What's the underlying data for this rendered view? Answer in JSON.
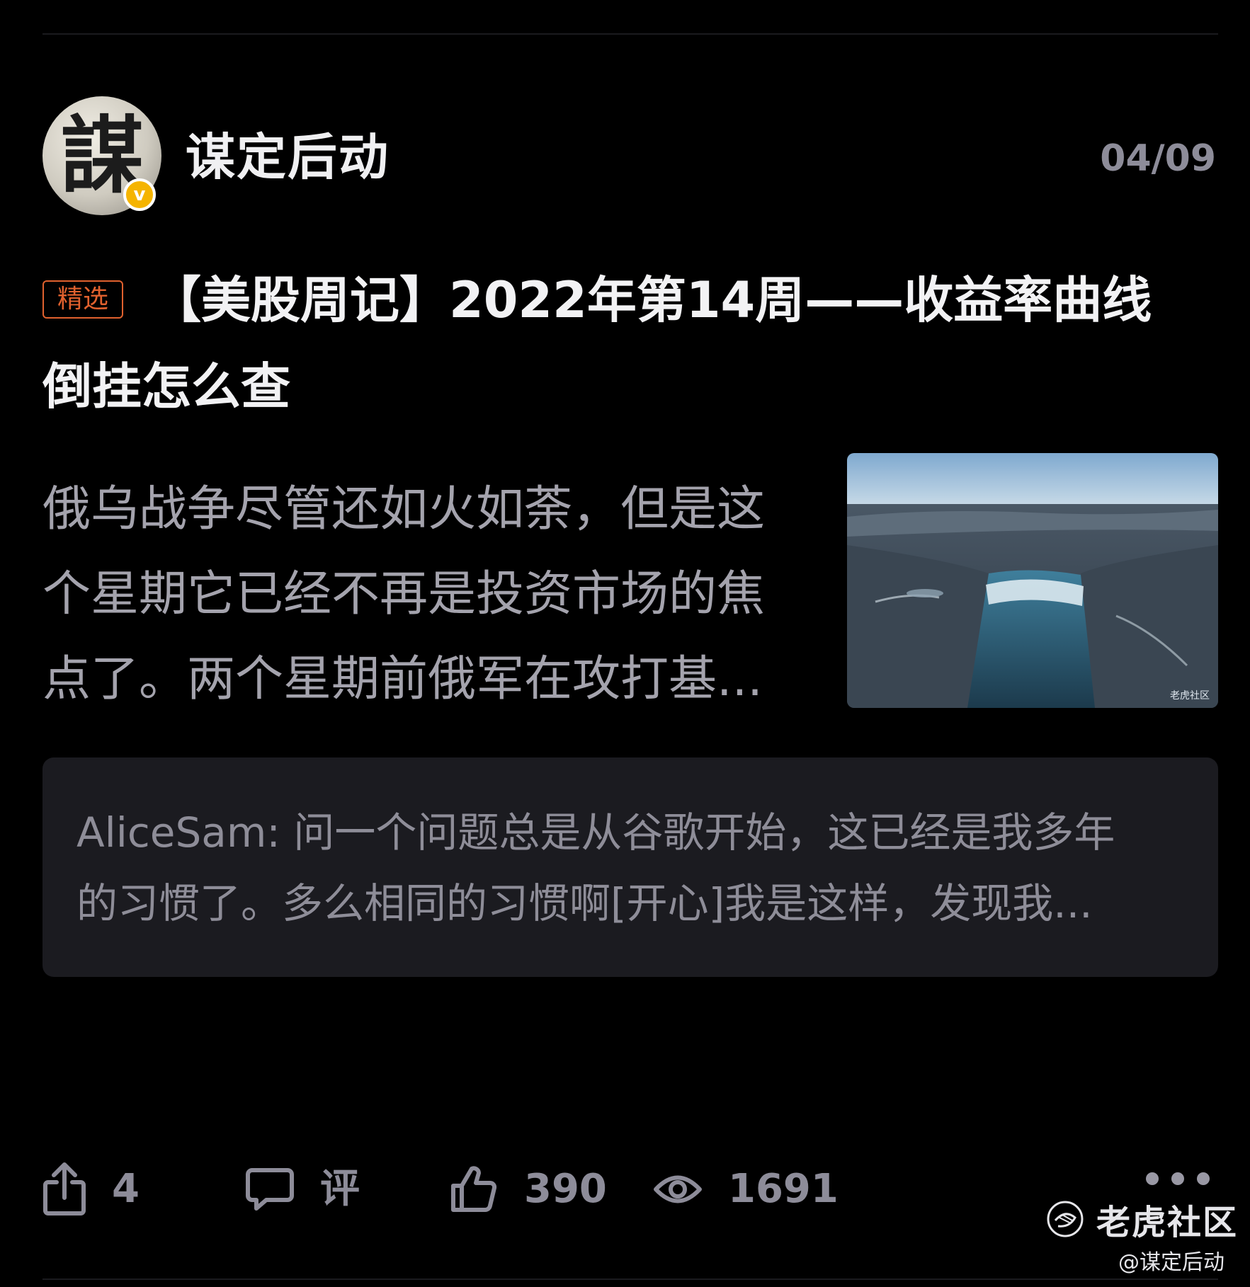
{
  "post": {
    "author_name": "谋定后动",
    "avatar_glyph": "謀",
    "verified_badge": "v",
    "date": "04/09",
    "featured_tag": "精选",
    "title_line1": "【美股周记】2022年第14周——收益率曲线",
    "title_line2": "倒挂怎么查",
    "excerpt_lines": [
      "俄乌战争尽管还如火如荼，但是这",
      "个星期它已经不再是投资市场的焦",
      "点了。两个星期前俄军在攻打基..."
    ],
    "thumbnail_watermark": "老虎社区",
    "thumbnail_icon": "landscape-waterfall-photo"
  },
  "top_comment": {
    "lines": [
      "AliceSam: 问一个问题总是从谷歌开始，这已经是我多年",
      "的习惯了。多么相同的习惯啊[开心]我是这样，发现我..."
    ]
  },
  "actions": {
    "share_count": "4",
    "comment_label": "评",
    "like_count": "390",
    "view_count": "1691"
  },
  "watermark": {
    "community_name": "老虎社区",
    "handle": "@谋定后动"
  },
  "colors": {
    "background": "#000000",
    "featured_accent": "#e0612e",
    "verified_badge": "#f5b400",
    "comment_card": "#1b1b20",
    "secondary_text": "#8d8c99"
  }
}
